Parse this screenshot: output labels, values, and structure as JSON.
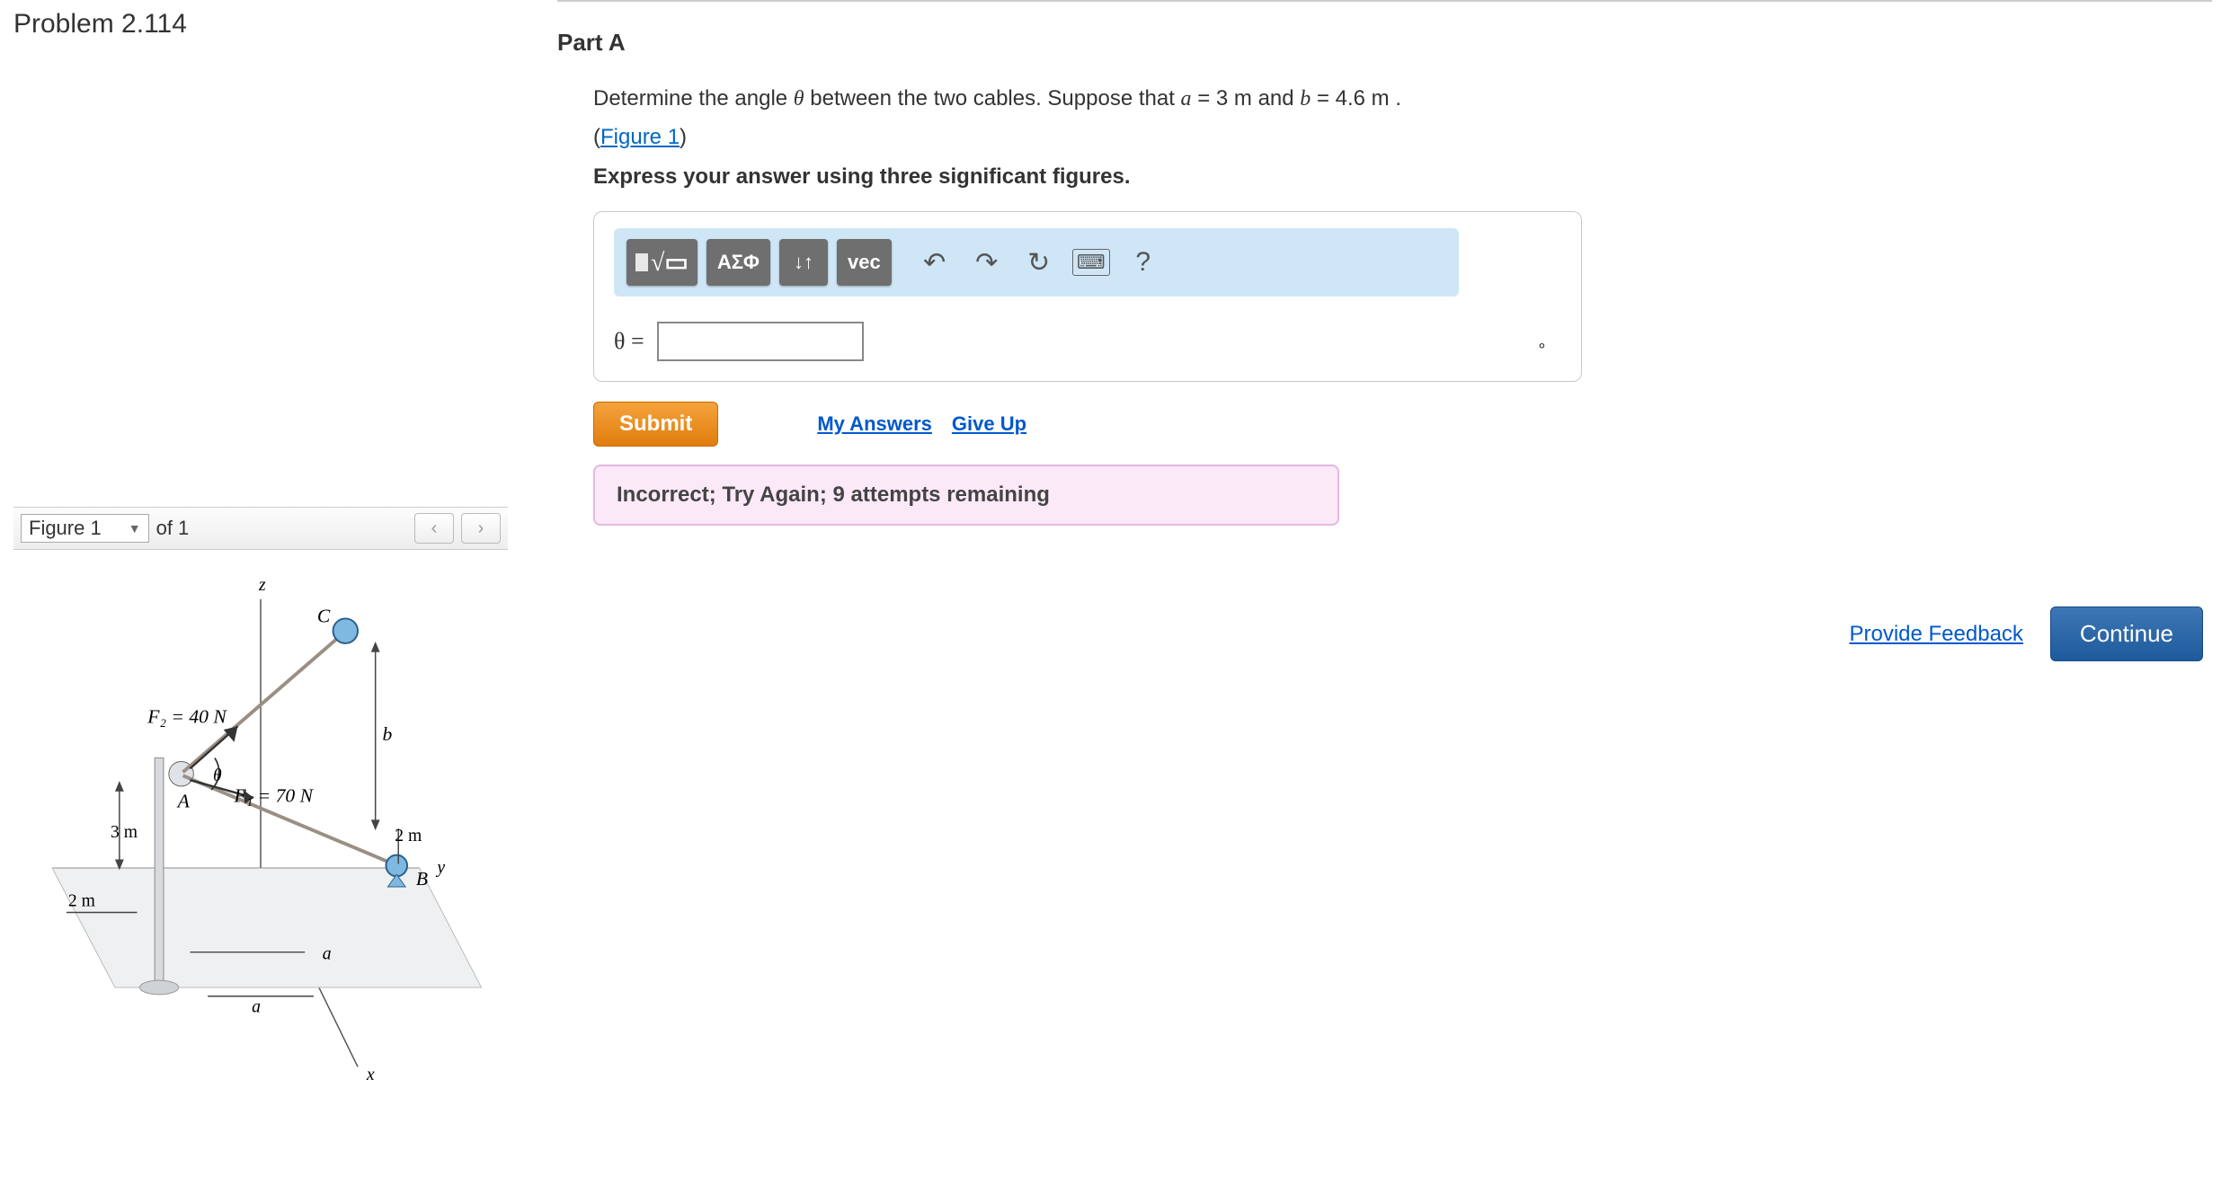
{
  "problem": {
    "title": "Problem 2.114"
  },
  "figure_nav": {
    "selected": "Figure 1",
    "count_label": "of 1"
  },
  "figure": {
    "z": "z",
    "x": "x",
    "y": "y",
    "C": "C",
    "B": "B",
    "A": "A",
    "a1": "a",
    "a2": "a",
    "b": "b",
    "theta": "θ",
    "F1": "F₁ = 70 N",
    "F2": "F₂ = 40 N",
    "dim3m": "3 m",
    "dim2m_left": "2 m",
    "dim2m_right": "2 m"
  },
  "part": {
    "label": "Part A",
    "prompt_pre": "Determine the angle ",
    "theta": "θ",
    "prompt_mid": " between the two cables. Suppose that ",
    "a_var": "a",
    "eq1": " = 3   m and ",
    "b_var": "b",
    "eq2": " = 4.6   m .",
    "figure_link": "Figure 1",
    "instruction": "Express your answer using three significant figures."
  },
  "toolbar": {
    "greek": "ΑΣΦ",
    "vec": "vec",
    "help": "?"
  },
  "input": {
    "label": "θ =",
    "value": "",
    "unit": "∘"
  },
  "actions": {
    "submit": "Submit",
    "my_answers": "My Answers",
    "give_up": "Give Up"
  },
  "feedback": {
    "message": "Incorrect; Try Again; 9 attempts remaining"
  },
  "footer": {
    "provide_feedback": "Provide Feedback",
    "continue": "Continue"
  }
}
